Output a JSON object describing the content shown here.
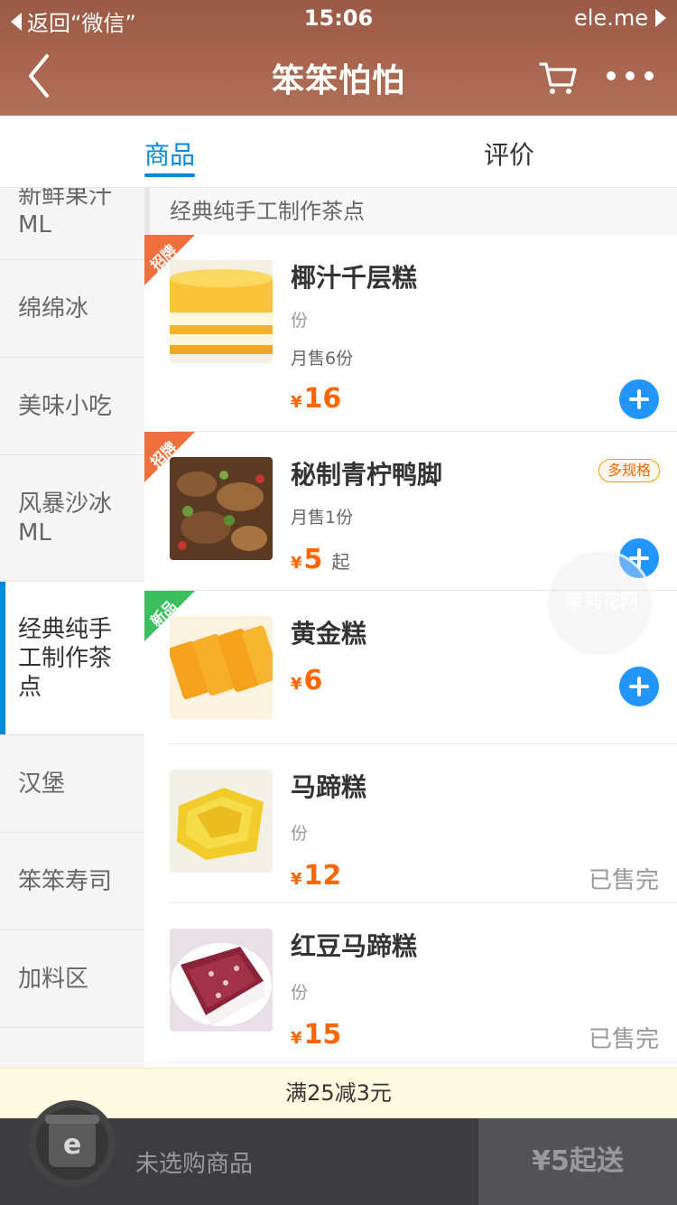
{
  "status_bar": {
    "back_label": "返回“微信”",
    "time": "15:06",
    "carrier": "ele.me"
  },
  "nav": {
    "title": "笨笨怕怕",
    "back_icon": "chevron-left-icon",
    "cart_icon": "cart-icon",
    "more_icon": "more-icon"
  },
  "tabs": {
    "goods": "商品",
    "reviews": "评价",
    "active": "goods",
    "accent_color": "#0089dc"
  },
  "sidebar": {
    "items": [
      {
        "label": "新鲜果汁ML"
      },
      {
        "label": "绵绵冰"
      },
      {
        "label": "美味小吃"
      },
      {
        "label": "风暴沙冰ML"
      },
      {
        "label": "经典纯手工制作茶点",
        "active": true
      },
      {
        "label": "汉堡"
      },
      {
        "label": "笨笨寿司"
      },
      {
        "label": "加料区"
      }
    ]
  },
  "section": {
    "title": "经典纯手工制作茶点"
  },
  "items": [
    {
      "name": "椰汁千层糕",
      "unit": "份",
      "sold": "月售6份",
      "currency": "¥",
      "price": "16",
      "ribbon": "招牌",
      "action": "add"
    },
    {
      "name": "秘制青柠鸭脚",
      "sold": "月售1份",
      "currency": "¥",
      "price": "5",
      "price_suffix": "起",
      "ribbon": "招牌",
      "badge": "多规格",
      "action": "add"
    },
    {
      "name": "黄金糕",
      "currency": "¥",
      "price": "6",
      "ribbon": "新品",
      "action": "add"
    },
    {
      "name": "马蹄糕",
      "unit": "份",
      "currency": "¥",
      "price": "12",
      "status": "已售完"
    },
    {
      "name": "红豆马蹄糕",
      "unit": "份",
      "currency": "¥",
      "price": "15",
      "status": "已售完"
    }
  ],
  "watermark": {
    "text": "茉莉花网"
  },
  "promo": {
    "text": "满25减3元"
  },
  "cart_bar": {
    "icon": "cart-logo-icon",
    "empty_text": "未选购商品",
    "min_order": "¥5起送"
  },
  "colors": {
    "price": "#ff6600",
    "add_button": "#2395ff",
    "ribbon_hot": "#f0703d",
    "ribbon_new": "#3bbf5f"
  }
}
